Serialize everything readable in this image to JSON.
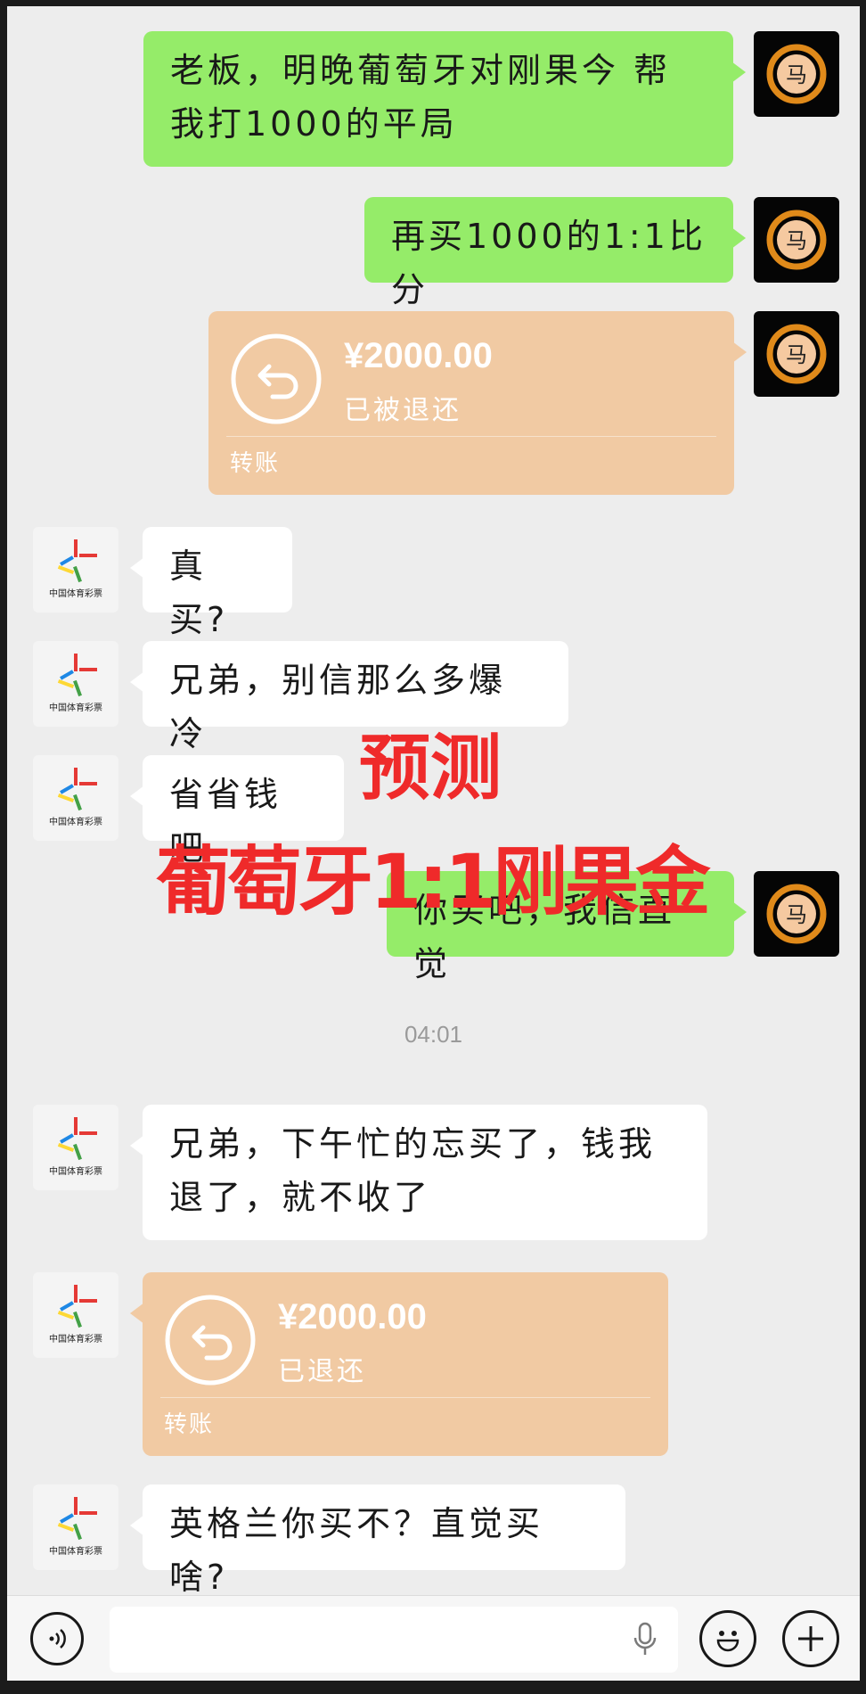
{
  "messages": {
    "m1": "老板，明晚葡萄牙对刚果今 帮我打1000的平局",
    "m2": "再买1000的1:1比分",
    "m3_amount": "¥2000.00",
    "m3_status": "已被退还",
    "m3_label": "转账",
    "m4": "真买?",
    "m5": "兄弟，别信那么多爆冷",
    "m6": "省省钱吧",
    "m7": "你买吧，我信直觉",
    "time": "04:01",
    "m8": "兄弟，下午忙的忘买了，钱我退了，就不收了",
    "m9_amount": "¥2000.00",
    "m9_status": "已退还",
    "m9_label": "转账",
    "m10": "英格兰你买不？直觉买啥?"
  },
  "overlay": {
    "line1": "预测",
    "line2": "葡萄牙1:1刚果金"
  },
  "avatars": {
    "other_logo_text": "中国体育彩票",
    "me_icon": "dragon-avatar"
  },
  "colors": {
    "green_bubble": "#95ec69",
    "transfer_bubble": "#f1caa3",
    "overlay_red": "#ef2a2a"
  }
}
